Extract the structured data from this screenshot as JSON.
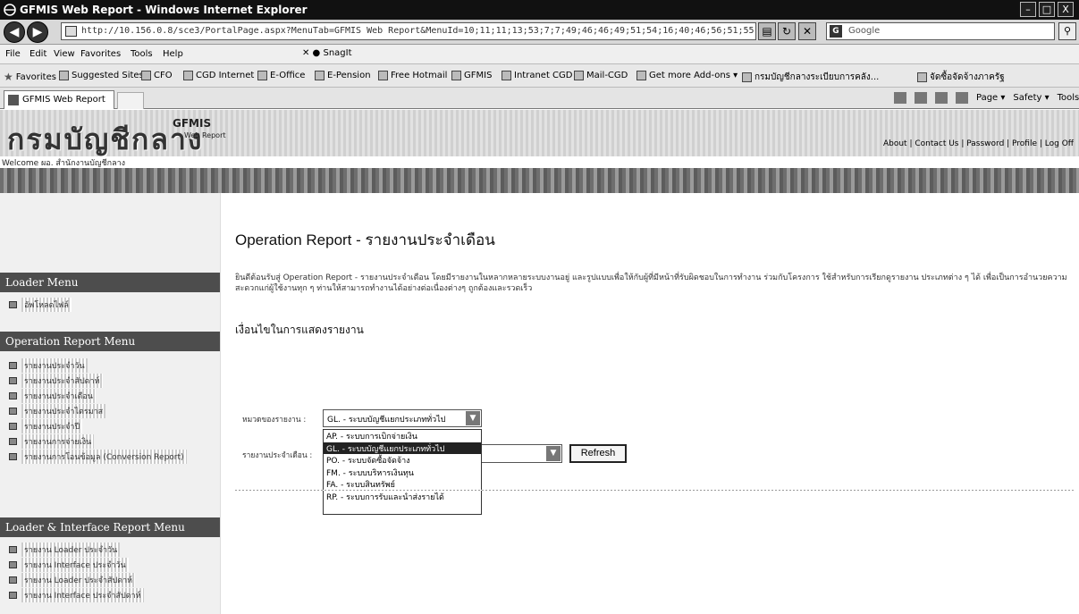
{
  "window": {
    "title": "GFMIS Web Report - Windows Internet Explorer",
    "min": "–",
    "max": "□",
    "close": "X"
  },
  "addressbar": {
    "url": "http://10.156.0.8/sce3/PortalPage.aspx?MenuTab=GFMIS Web Report&MenuId=10;11;11;13;53;7;7;49;46;46;49;51;54;16;40;46;56;51;55;56",
    "search_placeholder": "Google",
    "search_brand": "G"
  },
  "menubar": {
    "items": [
      "File",
      "Edit",
      "View",
      "Favorites",
      "Tools",
      "Help"
    ],
    "snagit": "SnagIt"
  },
  "favorites": {
    "label": "Favorites",
    "items": [
      "Suggested Sites ▾",
      "CFO",
      "CGD Internet",
      "E-Office",
      "E-Pension",
      "Free Hotmail",
      "GFMIS",
      "Intranet CGD",
      "Mail-CGD",
      "Get more Add-ons ▾",
      "กรมบัญชีกลางระเบียบการคลัง...",
      "จัดซื้อจัดจ้างภาครัฐ"
    ]
  },
  "tabs": {
    "active": "GFMIS Web Report"
  },
  "commandbar": {
    "page": "Page ▾",
    "safety": "Safety ▾",
    "tools": "Tools ▾"
  },
  "header": {
    "logo": "กรมบัญชีกลาง",
    "gfmis": "GFMIS",
    "web_report": "Web Report",
    "links": "About | Contact Us | Password | Profile | Log Off",
    "welcome": "Welcome  ผอ. สำนักงานบัญชีกลาง"
  },
  "sidebar": {
    "loader_menu": {
      "title": "Loader Menu",
      "items": [
        "อัพโหลดไฟล์"
      ]
    },
    "operation_menu": {
      "title": "Operation Report Menu",
      "items": [
        "รายงานประจำวัน",
        "รายงานประจำสัปดาห์",
        "รายงานประจำเดือน",
        "รายงานประจำไตรมาส",
        "รายงานประจำปี",
        "รายงานการจ่ายเงิน",
        "รายงานการโอนข้อมูล (Conversion Report)"
      ]
    },
    "interface_menu": {
      "title": "Loader & Interface Report Menu",
      "items": [
        "รายงาน Loader ประจำวัน",
        "รายงาน Interface ประจำวัน",
        "รายงาน Loader ประจำสัปดาห์",
        "รายงาน Interface ประจำสัปดาห์"
      ]
    }
  },
  "main": {
    "title": "Operation Report - รายงานประจำเดือน",
    "intro": "ยินดีต้อนรับสู่ Operation Report - รายงานประจำเดือน โดยมีรายงานในหลากหลายระบบงานอยู่ และรูปแบบเพื่อให้กับผู้ที่มีหน้าที่รับผิดชอบในการทำงาน ร่วมกับโครงการ ใช้สำหรับการเรียกดูรายงาน ประเภทต่าง ๆ ได้ เพื่อเป็นการอำนวยความสะดวกแก่ผู้ใช้งานทุก ๆ ท่านให้สามารถทำงานได้อย่างต่อเนื่องต่างๆ ถูกต้องและรวดเร็ว",
    "conditions_title": "เงื่อนไขในการแสดงรายงาน",
    "system_label": "หมวดของรายงาน  :",
    "report_label": "รายงานประจำเดือน  :",
    "system_selected": "GL. - ระบบบัญชีแยกประเภททั่วไป",
    "options": [
      "AP. - ระบบการเบิกจ่ายเงิน",
      "GL. - ระบบบัญชีแยกประเภททั่วไป",
      "PO. - ระบบจัดซื้อจัดจ้าง",
      "FM. - ระบบบริหารเงินทุน",
      "FA. - ระบบสินทรัพย์",
      "RP. - ระบบการรับและนำส่งรายได้"
    ],
    "selected_index": 1,
    "refresh": "Refresh",
    "arrow": "▼"
  }
}
